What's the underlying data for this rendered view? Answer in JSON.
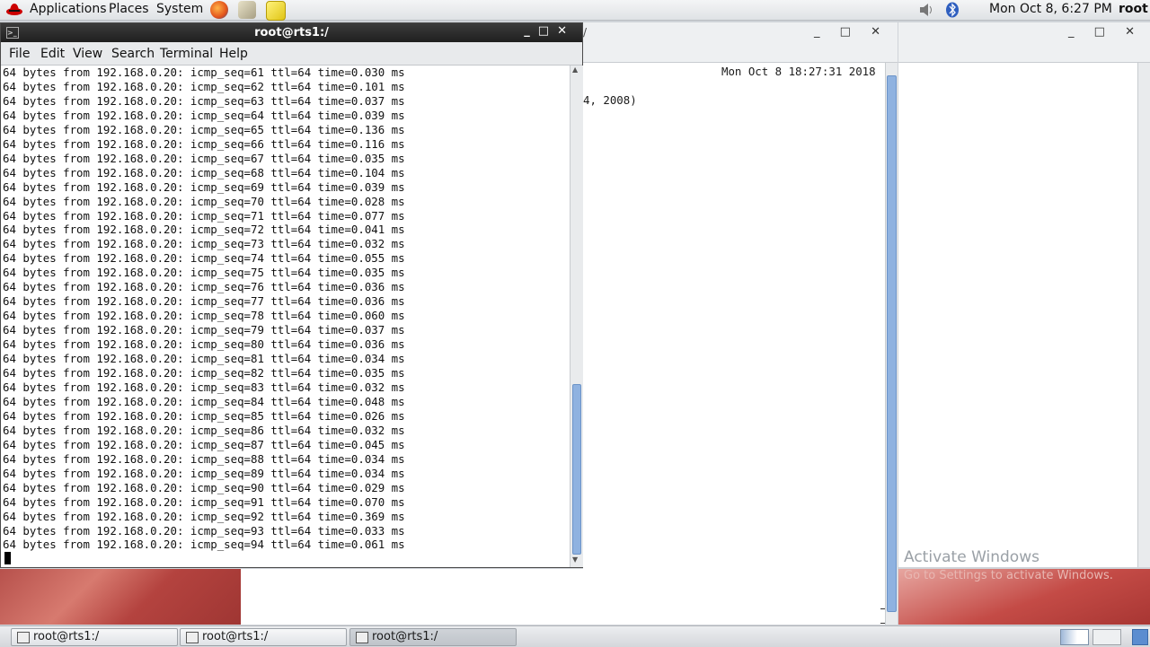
{
  "top_panel": {
    "applications": "Applications",
    "places": "Places",
    "system": "System",
    "clock": "Mon Oct  8,  6:27 PM",
    "user": "root"
  },
  "back_window": {
    "date_text": "Mon Oct  8 18:27:31 2018",
    "partial_text": "4, 2008)"
  },
  "terminal": {
    "title": "root@rts1:/",
    "menu": [
      "File",
      "Edit",
      "View",
      "Search",
      "Terminal",
      "Help"
    ],
    "lines": [
      "64 bytes from 192.168.0.20: icmp_seq=61 ttl=64 time=0.030 ms",
      "64 bytes from 192.168.0.20: icmp_seq=62 ttl=64 time=0.101 ms",
      "64 bytes from 192.168.0.20: icmp_seq=63 ttl=64 time=0.037 ms",
      "64 bytes from 192.168.0.20: icmp_seq=64 ttl=64 time=0.039 ms",
      "64 bytes from 192.168.0.20: icmp_seq=65 ttl=64 time=0.136 ms",
      "64 bytes from 192.168.0.20: icmp_seq=66 ttl=64 time=0.116 ms",
      "64 bytes from 192.168.0.20: icmp_seq=67 ttl=64 time=0.035 ms",
      "64 bytes from 192.168.0.20: icmp_seq=68 ttl=64 time=0.104 ms",
      "64 bytes from 192.168.0.20: icmp_seq=69 ttl=64 time=0.039 ms",
      "64 bytes from 192.168.0.20: icmp_seq=70 ttl=64 time=0.028 ms",
      "64 bytes from 192.168.0.20: icmp_seq=71 ttl=64 time=0.077 ms",
      "64 bytes from 192.168.0.20: icmp_seq=72 ttl=64 time=0.041 ms",
      "64 bytes from 192.168.0.20: icmp_seq=73 ttl=64 time=0.032 ms",
      "64 bytes from 192.168.0.20: icmp_seq=74 ttl=64 time=0.055 ms",
      "64 bytes from 192.168.0.20: icmp_seq=75 ttl=64 time=0.035 ms",
      "64 bytes from 192.168.0.20: icmp_seq=76 ttl=64 time=0.036 ms",
      "64 bytes from 192.168.0.20: icmp_seq=77 ttl=64 time=0.036 ms",
      "64 bytes from 192.168.0.20: icmp_seq=78 ttl=64 time=0.060 ms",
      "64 bytes from 192.168.0.20: icmp_seq=79 ttl=64 time=0.037 ms",
      "64 bytes from 192.168.0.20: icmp_seq=80 ttl=64 time=0.036 ms",
      "64 bytes from 192.168.0.20: icmp_seq=81 ttl=64 time=0.034 ms",
      "64 bytes from 192.168.0.20: icmp_seq=82 ttl=64 time=0.035 ms",
      "64 bytes from 192.168.0.20: icmp_seq=83 ttl=64 time=0.032 ms",
      "64 bytes from 192.168.0.20: icmp_seq=84 ttl=64 time=0.048 ms",
      "64 bytes from 192.168.0.20: icmp_seq=85 ttl=64 time=0.026 ms",
      "64 bytes from 192.168.0.20: icmp_seq=86 ttl=64 time=0.032 ms",
      "64 bytes from 192.168.0.20: icmp_seq=87 ttl=64 time=0.045 ms",
      "64 bytes from 192.168.0.20: icmp_seq=88 ttl=64 time=0.034 ms",
      "64 bytes from 192.168.0.20: icmp_seq=89 ttl=64 time=0.034 ms",
      "64 bytes from 192.168.0.20: icmp_seq=90 ttl=64 time=0.029 ms",
      "64 bytes from 192.168.0.20: icmp_seq=91 ttl=64 time=0.070 ms",
      "64 bytes from 192.168.0.20: icmp_seq=92 ttl=64 time=0.369 ms",
      "64 bytes from 192.168.0.20: icmp_seq=93 ttl=64 time=0.033 ms",
      "64 bytes from 192.168.0.20: icmp_seq=94 ttl=64 time=0.061 ms"
    ]
  },
  "watermark": {
    "line1": "Activate Windows",
    "line2": "Go to Settings to activate Windows."
  },
  "taskbar": {
    "tasks": [
      "root@rts1:/",
      "root@rts1:/",
      "root@rts1:/"
    ]
  },
  "colors": {
    "accent_scroll": "#8fb2e0",
    "titlebar": "#2b2b2b",
    "desktop_red": "#b4433f"
  }
}
